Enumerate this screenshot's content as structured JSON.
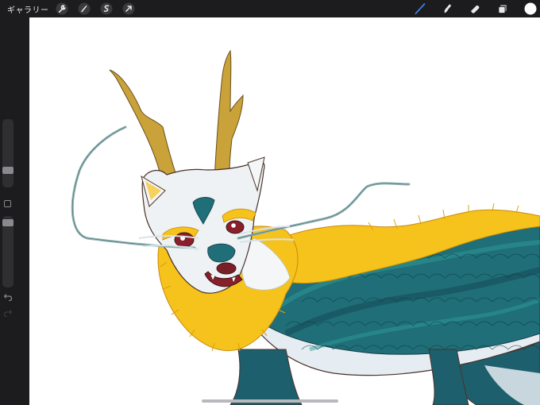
{
  "toolbar": {
    "gallery_label": "ギャラリー",
    "left_tools": [
      "wrench-icon",
      "magic-wand-icon",
      "selection-icon",
      "transform-arrow-icon"
    ],
    "right_tools": [
      "brush-icon",
      "smudge-icon",
      "eraser-icon",
      "layers-icon",
      "color-swatch"
    ],
    "active_tool": "brush",
    "active_color": "#ffffff",
    "accent_color": "#3f7ddb"
  },
  "sidebar": {
    "brush_size_level": 0.55,
    "opacity_level": 0.1,
    "modify_button": "square-icon",
    "undo_icon": "undo-icon",
    "redo_icon": "redo-icon"
  },
  "canvas": {
    "background": "#ffffff",
    "subject": "artwork-dragon",
    "palette": {
      "fur": "#f6c21c",
      "scales": "#1f6e78",
      "body": "#e6edf2",
      "horns": "#c9a23a",
      "line": "#5b3b2e"
    }
  }
}
